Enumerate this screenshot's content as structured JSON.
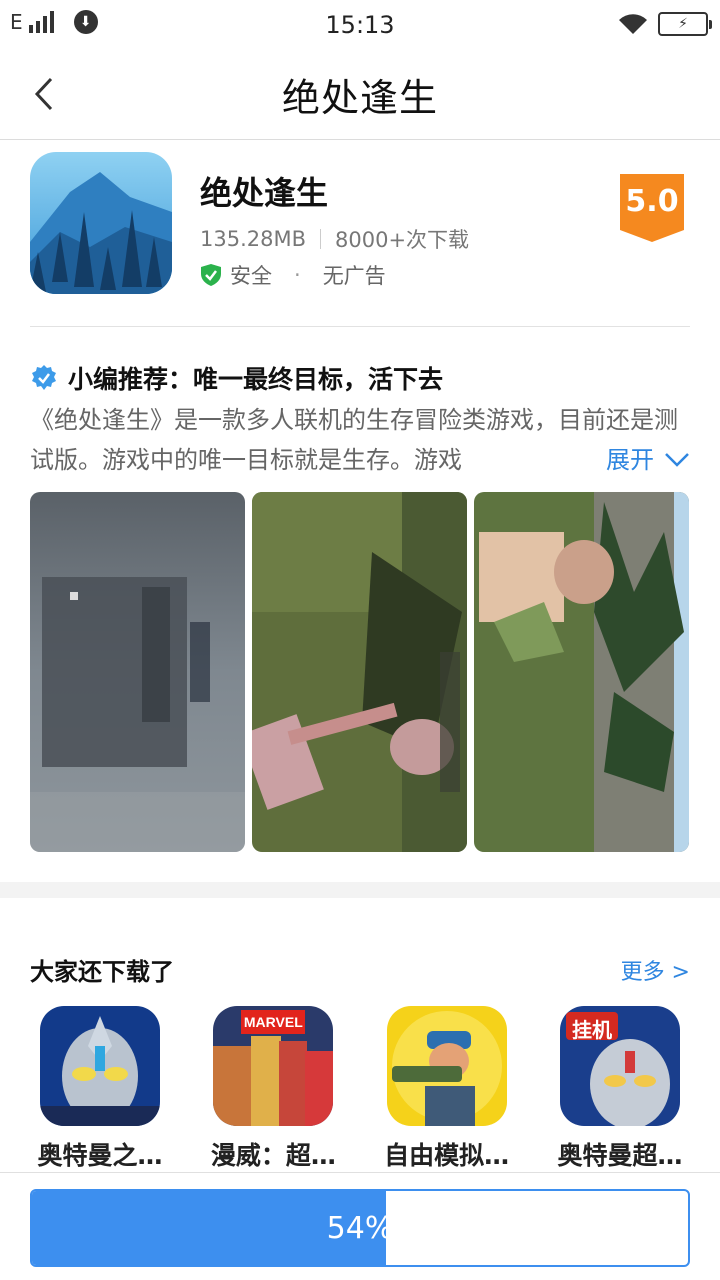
{
  "status_bar": {
    "network": "E",
    "time": "15:13",
    "battery_icon": "battery-charging-icon"
  },
  "nav": {
    "title": "绝处逢生"
  },
  "app": {
    "name": "绝处逢生",
    "size": "135.28MB",
    "downloads": "8000+次下载",
    "safe_label": "安全",
    "dot": "·",
    "ad_label": "无广告",
    "rating": "5.0"
  },
  "editor": {
    "title": "小编推荐：唯一最终目标，活下去",
    "description": "《绝处逢生》是一款多人联机的生存冒险类游戏，目前还是测试版。游戏中的唯一目标就是生存。游戏",
    "expand_label": "展开"
  },
  "screenshots": [
    "screenshot-menu",
    "screenshot-forest-axe",
    "screenshot-field-zombie"
  ],
  "recommend": {
    "title": "大家还下载了",
    "more_label": "更多 >",
    "items": [
      {
        "name": "奥特曼之…"
      },
      {
        "name": "漫威：超…"
      },
      {
        "name": "自由模拟…"
      },
      {
        "name": "奥特曼超…"
      }
    ],
    "badge_marvel": "MARVEL",
    "badge_guaji": "挂机"
  },
  "download": {
    "progress_label": "54%",
    "progress_fraction": 0.54
  },
  "colors": {
    "accent": "#3d8fef",
    "link": "#2f86e0",
    "rating_orange": "#f5891f",
    "safe_green": "#2bb24c"
  }
}
